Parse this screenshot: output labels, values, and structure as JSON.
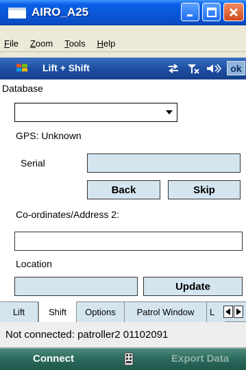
{
  "window": {
    "title": "AIRO_A25"
  },
  "menubar": {
    "items": [
      {
        "label_u": "F",
        "label_rest": "ile"
      },
      {
        "label_u": "Z",
        "label_rest": "oom"
      },
      {
        "label_u": "T",
        "label_rest": "ools"
      },
      {
        "label_u": "H",
        "label_rest": "elp"
      }
    ]
  },
  "device_bar": {
    "title": "Lift + Shift",
    "ok_label": "ok",
    "icons": [
      "sync-icon",
      "no-signal-icon",
      "volume-icon"
    ]
  },
  "form": {
    "database_label": "Database",
    "database_value": "",
    "gps_status": "GPS: Unknown",
    "serial_label": "Serial",
    "serial_value": "",
    "back_label": "Back",
    "skip_label": "Skip",
    "coordinates_label": "Co-ordinates/Address 2:",
    "coordinates_value": "",
    "location_label": "Location",
    "location_value": "",
    "update_label": "Update"
  },
  "tabs": [
    {
      "label": "Lift",
      "active": false
    },
    {
      "label": "Shift",
      "active": true
    },
    {
      "label": "Options",
      "active": false
    },
    {
      "label": "Patrol Window",
      "active": false
    },
    {
      "label": "L",
      "active": false
    }
  ],
  "status": {
    "text": "Not connected: patroller2 01102091"
  },
  "softkeys": {
    "left": "Connect",
    "right": "Export Data"
  },
  "colors": {
    "title_bar": "#0b56d6",
    "field_bg": "#d4e5f0",
    "softkey_bar": "#2c6b5e"
  }
}
